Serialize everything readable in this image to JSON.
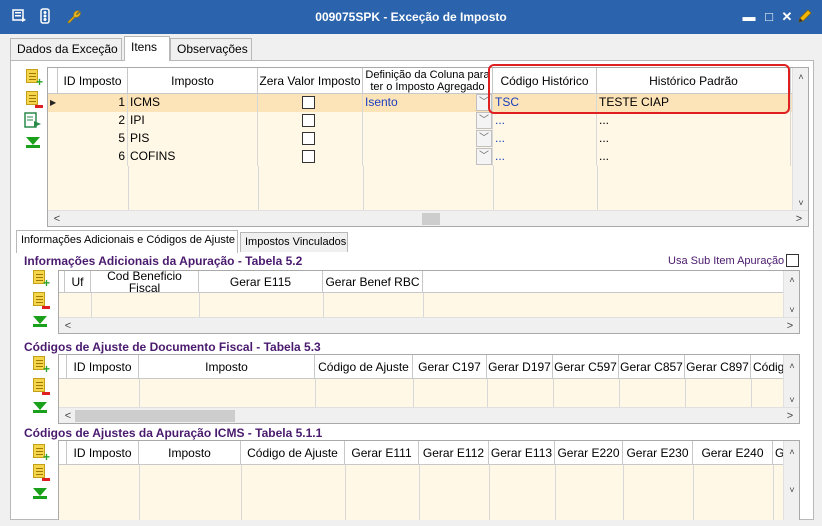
{
  "window": {
    "title": "009075SPK - Exceção de Imposto",
    "icons": [
      "menu-icon",
      "traffic-light-icon",
      "wrench-icon"
    ],
    "controls": {
      "minimize": "▬",
      "maximize": "□",
      "close": "✕"
    }
  },
  "tabs": [
    {
      "label": "Dados da Exceção",
      "active": false
    },
    {
      "label": "Itens",
      "active": true
    },
    {
      "label": "Observações",
      "active": false
    }
  ],
  "items_grid": {
    "columns": [
      "ID Imposto",
      "Imposto",
      "Zera Valor Imposto",
      "Definição da Coluna para ter o Imposto Agregado",
      "Código Histórico",
      "Histórico Padrão"
    ],
    "rows": [
      {
        "id": "1",
        "imposto": "ICMS",
        "zera": false,
        "definicao": "Isento",
        "codigo": "TSC",
        "historico": "TESTE CIAP",
        "selected": true
      },
      {
        "id": "2",
        "imposto": "IPI",
        "zera": false,
        "definicao": "",
        "codigo": "...",
        "historico": "...",
        "selected": false
      },
      {
        "id": "5",
        "imposto": "PIS",
        "zera": false,
        "definicao": "",
        "codigo": "...",
        "historico": "...",
        "selected": false
      },
      {
        "id": "6",
        "imposto": "COFINS",
        "zera": false,
        "definicao": "",
        "codigo": "...",
        "historico": "...",
        "selected": false
      }
    ]
  },
  "subtabs": [
    {
      "label": "Informações Adicionais e Códigos de Ajuste",
      "active": true
    },
    {
      "label": "Impostos Vinculados",
      "active": false
    }
  ],
  "section1": {
    "title": "Informações Adicionais da Apuração - Tabela 5.2",
    "usa_sub_item": "Usa Sub Item Apuração",
    "columns": [
      "Uf",
      "Cod Beneficio Fiscal",
      "Gerar E115",
      "Gerar Benef RBC"
    ]
  },
  "section2": {
    "title": "Códigos de Ajuste de Documento Fiscal - Tabela 5.3",
    "columns": [
      "ID Imposto",
      "Imposto",
      "Código de Ajuste",
      "Gerar C197",
      "Gerar D197",
      "Gerar C597",
      "Gerar C857",
      "Gerar C897",
      "Códig"
    ]
  },
  "section3": {
    "title": "Códigos de Ajustes da Apuração ICMS - Tabela 5.1.1",
    "columns": [
      "ID Imposto",
      "Imposto",
      "Código de Ajuste",
      "Gerar E111",
      "Gerar E112",
      "Gerar E113",
      "Gerar E220",
      "Gerar E230",
      "Gerar E240",
      "G"
    ]
  },
  "glyphs": {
    "left": "<",
    "right": ">",
    "up": "˄",
    "down": "˅",
    "row_pointer": "▶",
    "combo": "﹀"
  },
  "colors": {
    "titlebar": "#2b64ac",
    "grid_bg": "#fff8e6",
    "selected_row": "#fde3b8",
    "highlight": "#e02020",
    "section_title": "#4a1a6e"
  }
}
